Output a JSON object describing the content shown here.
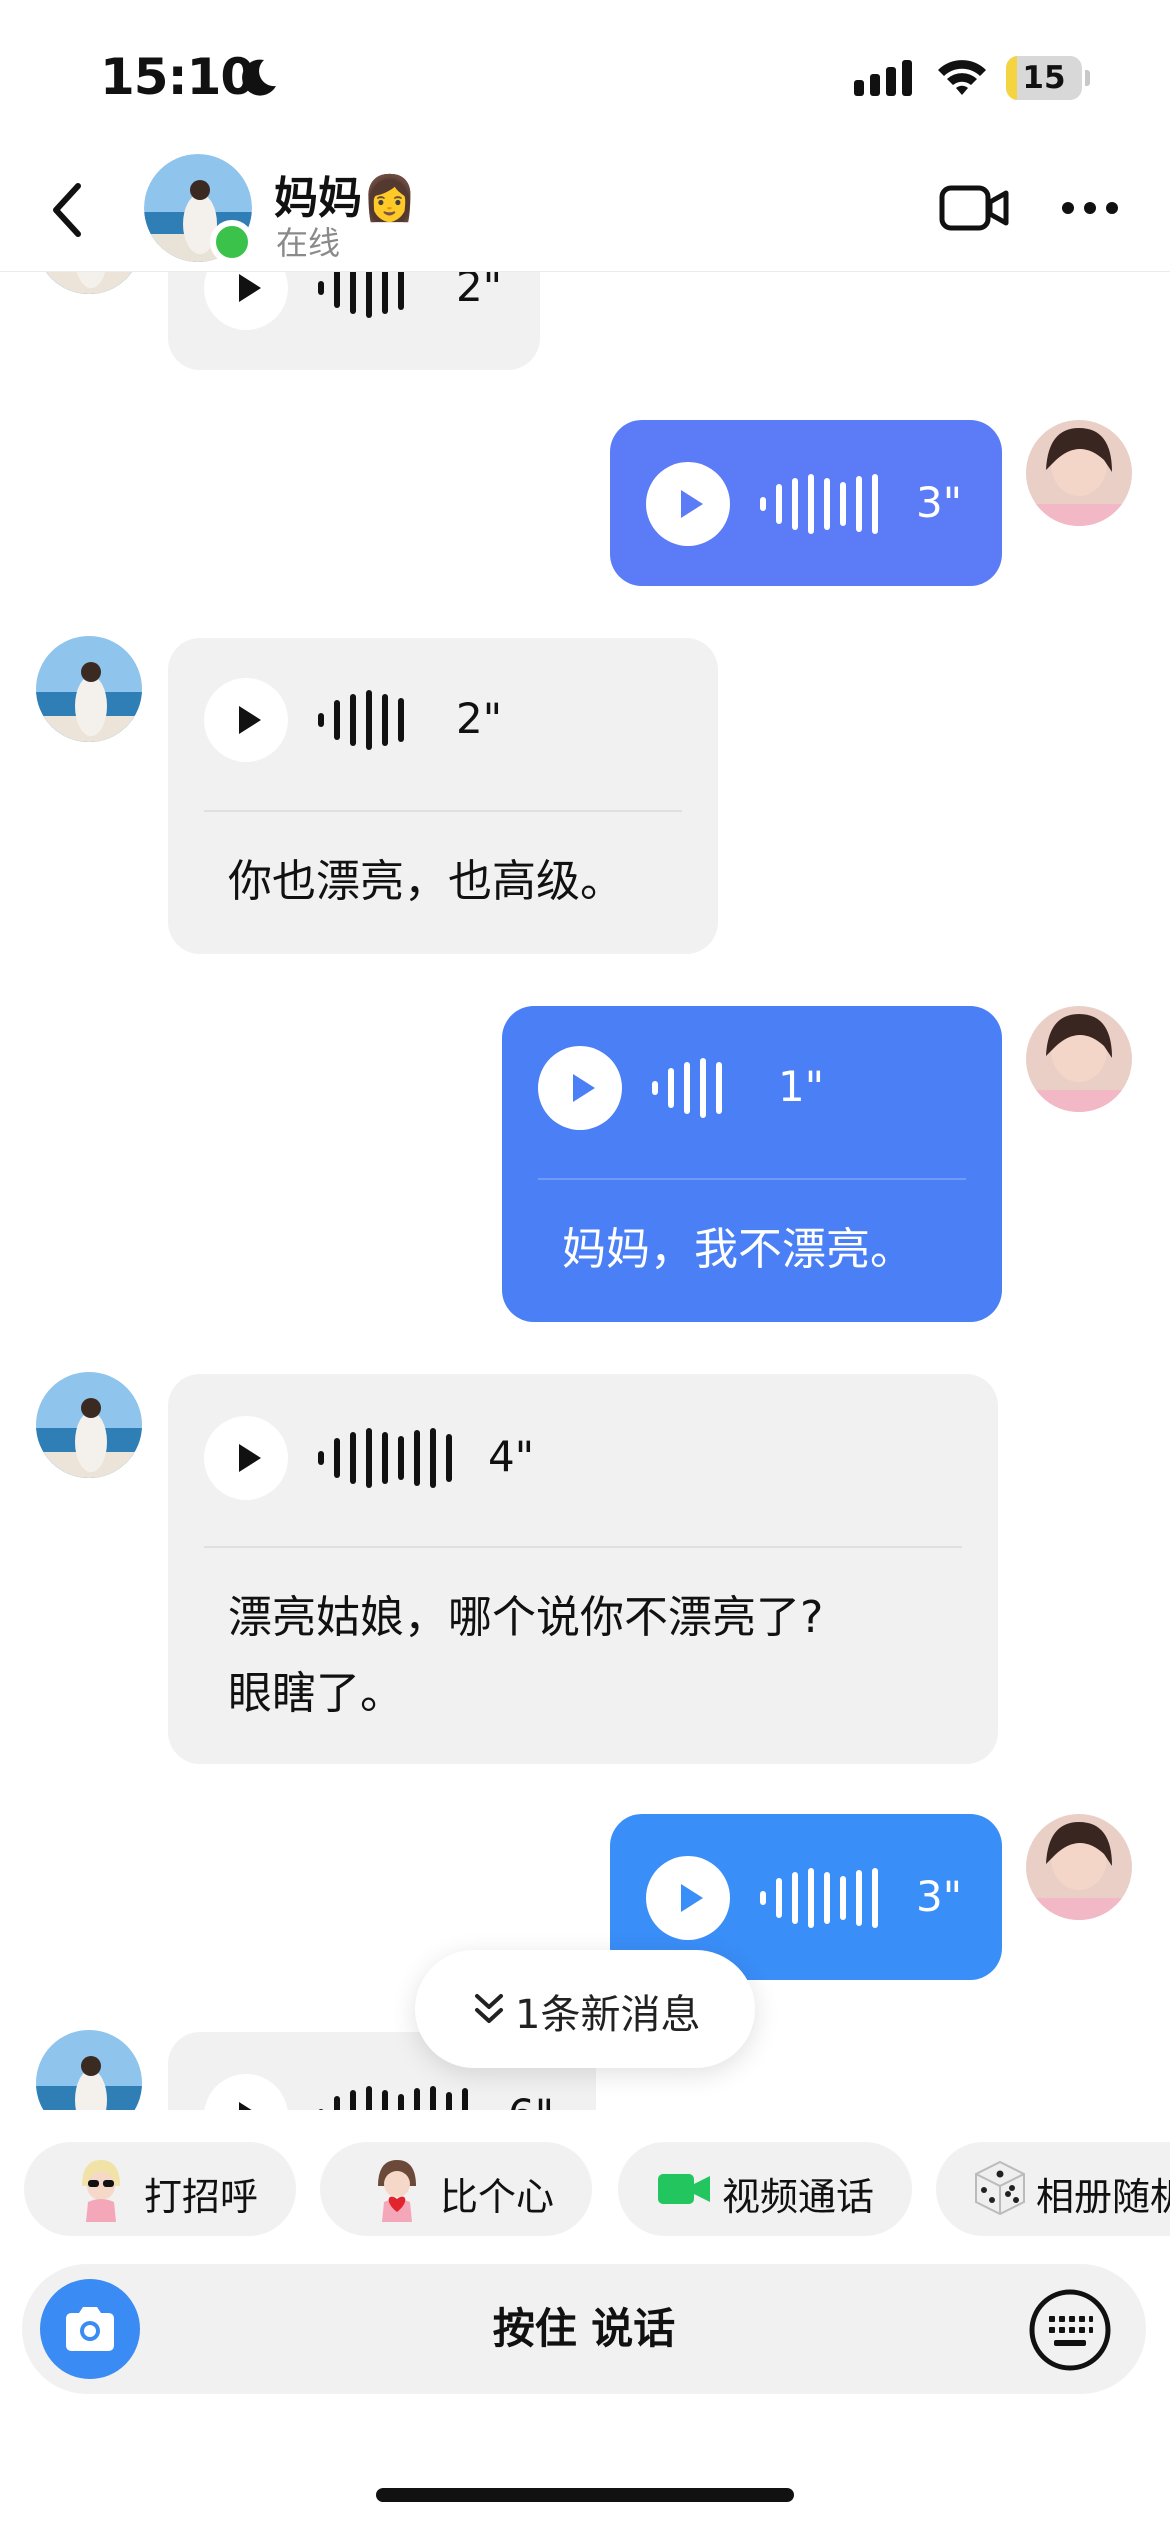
{
  "status_bar": {
    "time": "15:10",
    "battery": "15",
    "battery_fraction": 0.15
  },
  "header": {
    "contact_name": "妈妈👩",
    "status": "在线"
  },
  "messages": [
    {
      "direction": "in",
      "duration": "2\"",
      "text": ""
    },
    {
      "direction": "out",
      "duration": "3\"",
      "text": ""
    },
    {
      "direction": "in",
      "duration": "2\"",
      "text": "你也漂亮，也高级。"
    },
    {
      "direction": "out",
      "duration": "1\"",
      "text": "妈妈，我不漂亮。"
    },
    {
      "direction": "in",
      "duration": "4\"",
      "text_lines": [
        "漂亮姑娘，哪个说你不漂亮了?",
        "眼瞎了。"
      ]
    },
    {
      "direction": "out",
      "duration": "3\"",
      "text": ""
    },
    {
      "direction": "in",
      "duration": "6\"",
      "text": ""
    }
  ],
  "new_messages_pill": "1条新消息",
  "quick_replies": [
    {
      "label": "打招呼",
      "icon": "sunglasses-girl-sticker-icon"
    },
    {
      "label": "比个心",
      "icon": "heart-girl-sticker-icon"
    },
    {
      "label": "视频通话",
      "icon": "video-camera-icon"
    },
    {
      "label": "相册随机",
      "icon": "dice-icon"
    }
  ],
  "input_bar": {
    "hold_to_talk": "按住 说话"
  },
  "colors": {
    "out_bubble_1": "#5b7cf6",
    "out_bubble_2": "#4a7ff5",
    "out_bubble_3": "#3a8ef8",
    "in_bubble": "#f1f1f1",
    "online": "#3bc24a",
    "camera": "#3b8bf4"
  }
}
